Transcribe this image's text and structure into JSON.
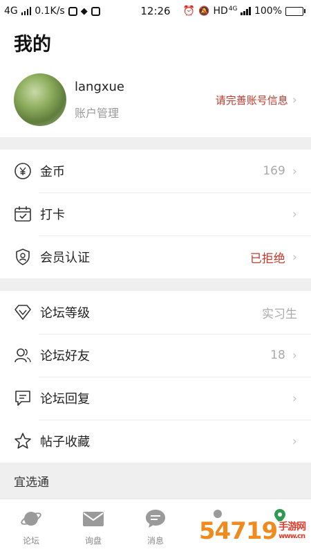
{
  "status_bar": {
    "network": "4G",
    "speed": "0.1K/s",
    "time": "12:26",
    "hd": "HD",
    "hd_network": "4G",
    "battery": "100%"
  },
  "page_title": "我的",
  "profile": {
    "username": "langxue",
    "account_manage": "账户管理",
    "complete_info": "请完善账号信息"
  },
  "group1": [
    {
      "label": "金币",
      "value": "169",
      "icon": "yen-coin-icon"
    },
    {
      "label": "打卡",
      "value": "",
      "icon": "calendar-check-icon"
    },
    {
      "label": "会员认证",
      "value": "已拒绝",
      "icon": "shield-user-icon"
    }
  ],
  "group2": [
    {
      "label": "论坛等级",
      "value": "实习生",
      "icon": "diamond-icon"
    },
    {
      "label": "论坛好友",
      "value": "18",
      "icon": "friends-icon"
    },
    {
      "label": "论坛回复",
      "value": "",
      "icon": "reply-icon"
    },
    {
      "label": "帖子收藏",
      "value": "",
      "icon": "star-icon"
    }
  ],
  "section_label": "宜选通",
  "tabs": [
    {
      "label": "论坛",
      "icon": "planet-icon"
    },
    {
      "label": "询盘",
      "icon": "mail-icon"
    },
    {
      "label": "消息",
      "icon": "chat-icon"
    },
    {
      "label": "",
      "icon": "profile-icon"
    },
    {
      "label": "",
      "icon": "location-icon"
    }
  ],
  "watermark": {
    "main": "54719",
    "sub1": "手游网",
    "sub2": "www.cn"
  },
  "colors": {
    "accent_red": "#c0392b",
    "muted": "#999999",
    "background": "#efefef"
  }
}
